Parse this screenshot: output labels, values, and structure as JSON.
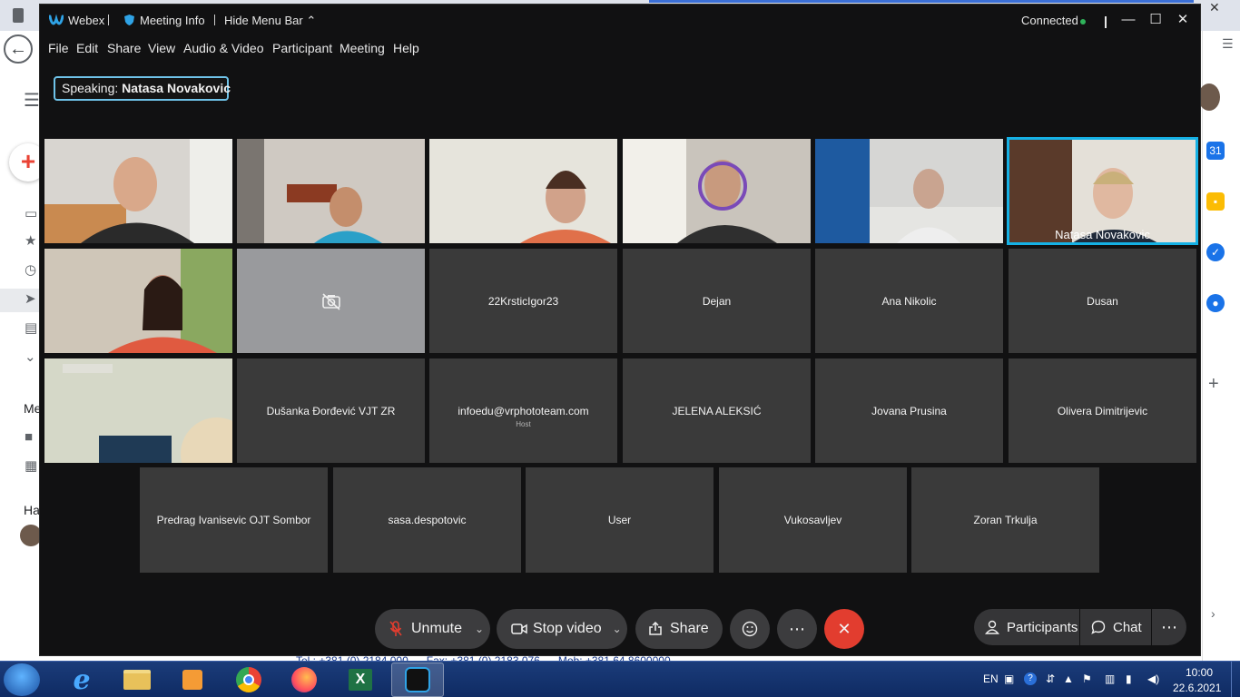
{
  "window": {
    "app_name": "Webex",
    "meeting_info": "Meeting Info",
    "hide_menu_bar": "Hide Menu Bar",
    "status": "Connected"
  },
  "menu": [
    "File",
    "Edit",
    "Share",
    "View",
    "Audio & Video",
    "Participant",
    "Meeting",
    "Help"
  ],
  "speaking": {
    "label": "Speaking:",
    "name": "Natasa Novakovic"
  },
  "participants": {
    "video_label": "Natasa Novakovic",
    "row2": [
      "22KrsticIgor23",
      "Dejan",
      "Ana Nikolic",
      "Dusan"
    ],
    "row3": [
      "Dušanka Đorđević VJT ZR",
      "infoedu@vrphototeam.com",
      "JELENA ALEKSIĆ",
      "Jovana Prusina",
      "Olivera Dimitrijevic"
    ],
    "host_label": "Host",
    "row4": [
      "Predrag Ivanisevic OJT Sombor",
      "sasa.despotovic",
      "User",
      "Vukosavljev",
      "Zoran Trkulja"
    ]
  },
  "controls": {
    "unmute": "Unmute",
    "stop_video": "Stop video",
    "share": "Share",
    "participants": "Participants",
    "chat": "Chat"
  },
  "taskbar": {
    "language": "EN",
    "time": "10:00",
    "date": "22.6.2021"
  },
  "colors": {
    "accent_active_speaker": "#15b1e5",
    "end_call": "#e23d2f",
    "mic_muted": "#e23d2f",
    "connected": "#2fb35a"
  }
}
